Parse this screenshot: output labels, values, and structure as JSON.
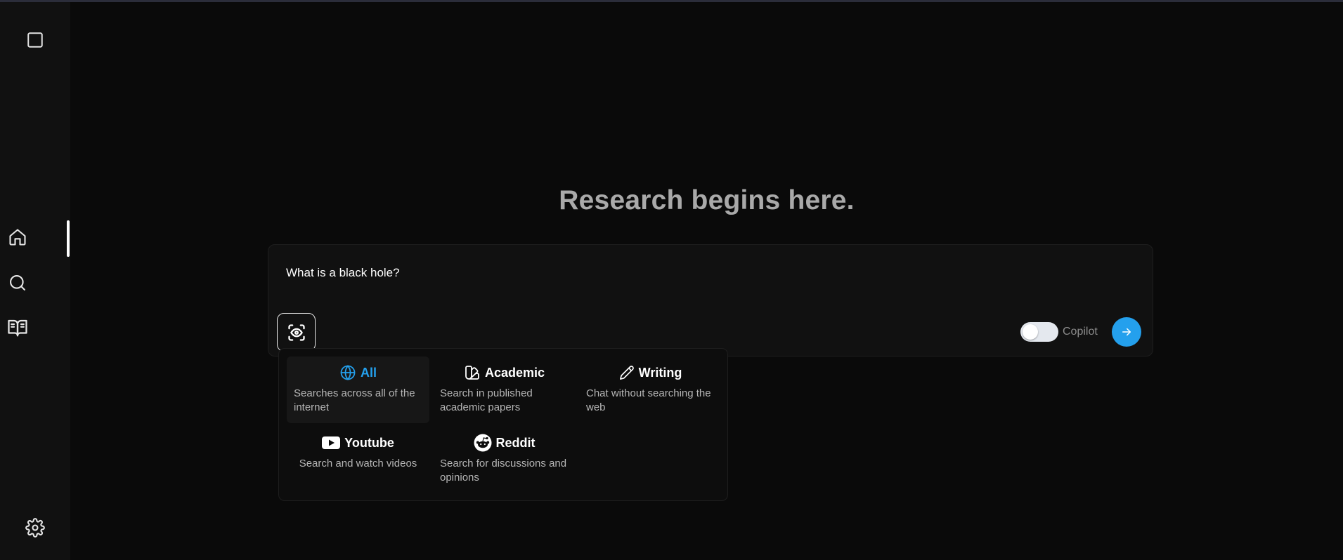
{
  "colors": {
    "accent": "#24a0ed",
    "background": "#0a0a0a",
    "sidebar": "#111111",
    "hero_text": "#a9a9a9"
  },
  "sidebar": {
    "items": [
      {
        "name": "new-chat",
        "icon": "square-icon"
      },
      {
        "name": "home",
        "icon": "home-icon",
        "active": true
      },
      {
        "name": "discover",
        "icon": "search-icon"
      },
      {
        "name": "library",
        "icon": "book-open-icon"
      },
      {
        "name": "settings",
        "icon": "gear-icon"
      }
    ]
  },
  "main": {
    "hero_title": "Research begins here.",
    "search": {
      "query": "What is a black hole?",
      "focus_icon": "scan-eye-icon",
      "copilot_label": "Copilot",
      "copilot_enabled": false,
      "send_icon": "arrow-right-icon"
    },
    "focus_modes": [
      {
        "title": "All",
        "description": "Searches across all of the internet",
        "icon": "globe-icon",
        "selected": true
      },
      {
        "title": "Academic",
        "description": "Search in published academic papers",
        "icon": "swatch-book-icon",
        "selected": false
      },
      {
        "title": "Writing",
        "description": "Chat without searching the web",
        "icon": "pencil-icon",
        "selected": false
      },
      {
        "title": "Youtube",
        "description": "Search and watch videos",
        "icon": "youtube-icon",
        "selected": false
      },
      {
        "title": "Reddit",
        "description": "Search for discussions and opinions",
        "icon": "reddit-icon",
        "selected": false
      }
    ]
  }
}
